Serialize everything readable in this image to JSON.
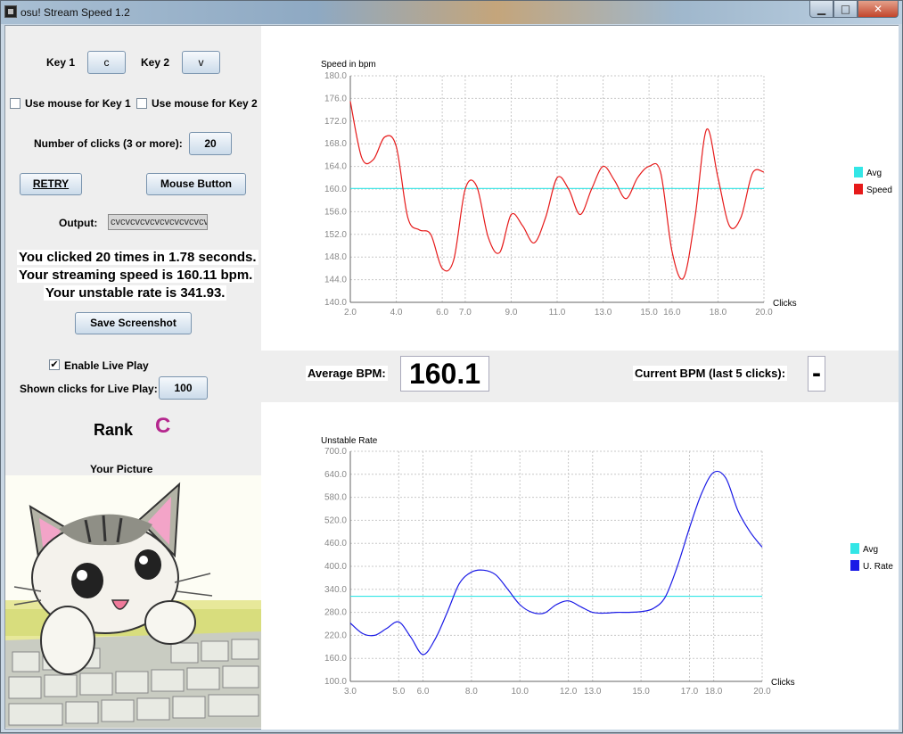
{
  "window": {
    "title": "osu! Stream Speed 1.2",
    "min": "▁",
    "max": "□",
    "close": "✕"
  },
  "controls": {
    "key1_label": "Key 1",
    "key1_value": "c",
    "key2_label": "Key 2",
    "key2_value": "v",
    "mouse_key1": "Use mouse for Key 1",
    "mouse_key2": "Use mouse for Key 2",
    "clicks_label": "Number of clicks (3 or more):",
    "clicks_value": "20",
    "retry": "RETRY",
    "mouse_button": "Mouse Button",
    "output_label": "Output:",
    "output_value": "cvcvcvcvcvcvcvcvcvcv",
    "result_line1": "You clicked 20 times in 1.78 seconds.",
    "result_line2": "Your streaming speed is 160.11 bpm.",
    "result_line3": "Your unstable rate is 341.93.",
    "save_screenshot": "Save Screenshot",
    "live_play_label": "Enable Live Play",
    "live_play_checked": true,
    "shown_clicks_label": "Shown clicks for Live Play:",
    "shown_clicks_value": "100",
    "rank_label": "Rank",
    "rank_value": "C",
    "rank_color": "#b5278e",
    "picture_label": "Your Picture"
  },
  "bpm_bar": {
    "avg_label": "Average BPM:",
    "avg_value": "160.1",
    "current_label": "Current BPM (last 5 clicks):",
    "current_value": "-"
  },
  "chart_data": [
    {
      "type": "line",
      "ylabel": "Speed in bpm",
      "xlabel": "Clicks",
      "xlim": [
        2,
        20
      ],
      "ylim": [
        140,
        180
      ],
      "xticks": [
        "2.0",
        "4.0",
        "6.0",
        "7.0",
        "9.0",
        "11.0",
        "13.0",
        "15.0",
        "16.0",
        "18.0",
        "20.0"
      ],
      "xtick_values": [
        2,
        4,
        6,
        7,
        9,
        11,
        13,
        15,
        16,
        18,
        20
      ],
      "yticks": [
        "140.0",
        "144.0",
        "148.0",
        "152.0",
        "156.0",
        "160.0",
        "164.0",
        "168.0",
        "172.0",
        "176.0",
        "180.0"
      ],
      "grid": true,
      "legend_position": "right",
      "avg": 160.11,
      "series": [
        {
          "name": "Avg",
          "color": "#33e6e6",
          "x": [
            2,
            20
          ],
          "values": [
            160.11,
            160.11
          ]
        },
        {
          "name": "Speed",
          "color": "#e61a1a",
          "x": [
            2,
            2.5,
            3,
            3.5,
            4,
            4.5,
            5,
            5.5,
            6,
            6.5,
            7,
            7.5,
            8,
            8.5,
            9,
            9.5,
            10,
            10.5,
            11,
            11.5,
            12,
            12.5,
            13,
            13.5,
            14,
            14.5,
            15,
            15.5,
            16,
            16.5,
            17,
            17.5,
            18,
            18.5,
            19,
            19.5,
            20
          ],
          "values": [
            175.5,
            165.5,
            165.2,
            169.2,
            167.5,
            155,
            152.8,
            152,
            146,
            147.5,
            160,
            160.5,
            151.5,
            148.8,
            155.5,
            153.5,
            150.5,
            155,
            162,
            160,
            155.5,
            160,
            164,
            161.5,
            158.3,
            162,
            164,
            163,
            149,
            144.3,
            155,
            170.5,
            162,
            153.5,
            155,
            162.8,
            163
          ]
        }
      ]
    },
    {
      "type": "line",
      "ylabel": "Unstable Rate",
      "xlabel": "Clicks",
      "xlim": [
        3,
        20
      ],
      "ylim": [
        100,
        700
      ],
      "xticks": [
        "3.0",
        "5.0",
        "6.0",
        "8.0",
        "10.0",
        "12.0",
        "13.0",
        "15.0",
        "17.0",
        "18.0",
        "20.0"
      ],
      "xtick_values": [
        3,
        5,
        6,
        8,
        10,
        12,
        13,
        15,
        17,
        18,
        20
      ],
      "yticks": [
        "100.0",
        "160.0",
        "220.0",
        "280.0",
        "340.0",
        "400.0",
        "460.0",
        "520.0",
        "580.0",
        "640.0",
        "700.0"
      ],
      "grid": true,
      "legend_position": "right",
      "avg": 341.93,
      "series": [
        {
          "name": "Avg",
          "color": "#33e6e6",
          "x": [
            3,
            20
          ],
          "values": [
            322,
            322
          ]
        },
        {
          "name": "U. Rate",
          "color": "#1a1ae6",
          "x": [
            3,
            3.5,
            4,
            4.5,
            5,
            5.5,
            6,
            6.5,
            7,
            7.5,
            8,
            8.5,
            9,
            9.5,
            10,
            10.5,
            11,
            11.5,
            12,
            12.5,
            13,
            13.5,
            14,
            14.5,
            15,
            15.5,
            16,
            16.5,
            17,
            17.5,
            18,
            18.5,
            19,
            19.5,
            20
          ],
          "values": [
            252,
            225,
            220,
            238,
            255,
            215,
            170,
            210,
            280,
            355,
            385,
            390,
            378,
            340,
            300,
            280,
            278,
            300,
            310,
            295,
            280,
            278,
            280,
            280,
            282,
            290,
            320,
            400,
            500,
            590,
            645,
            630,
            545,
            490,
            450
          ]
        }
      ]
    }
  ]
}
